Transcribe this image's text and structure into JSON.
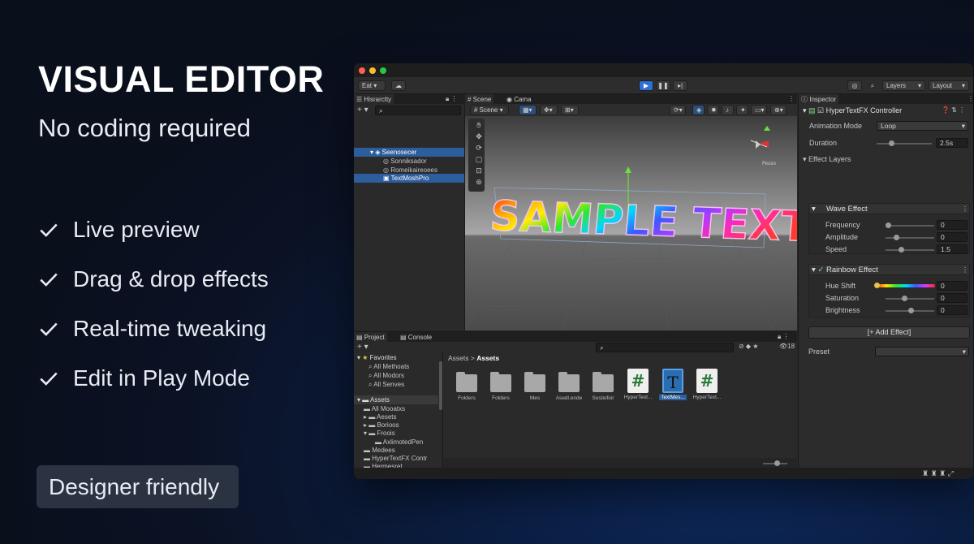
{
  "hero": {
    "title": "VISUAL EDITOR",
    "subtitle": "No coding required",
    "features": [
      "Live preview",
      "Drag & drop effects",
      "Real-time tweaking",
      "Edit in Play Mode"
    ],
    "badge": "Designer friendly"
  },
  "colors": {
    "accent": "#2c6fd6",
    "check": "#e8ebf2",
    "badge_bg": "#2b3343"
  },
  "editor": {
    "toolbar": {
      "left_btn": "Eat ▾",
      "layers": "Layers",
      "layout": "Layout"
    },
    "hierarchy": {
      "tab": "Hisrarctty",
      "items": [
        "Seenosecer",
        "Sonniksador",
        "Romeikaireoees",
        "TextMoshPro"
      ]
    },
    "scene": {
      "tabs": [
        "Scene",
        "Cama"
      ],
      "dropdown": "Scene",
      "gizmo_label": "Pesso",
      "sample_text": "SAMPLE TEXT"
    },
    "inspector": {
      "tab": "Inspector",
      "component": "HyperTextFX Controller",
      "animation_mode_label": "Animation Mode",
      "animation_mode_value": "Loop",
      "duration_label": "Duration",
      "duration_value": "2.5s",
      "effect_layers_label": "Effect Layers",
      "wave": {
        "title": "Wave Effect",
        "frequency_label": "Frequency",
        "frequency_value": "0",
        "amplitude_label": "Amplitude",
        "amplitude_value": "0",
        "speed_label": "Speed",
        "speed_value": "1.5"
      },
      "rainbow": {
        "title": "Rainbow Effect",
        "hue_label": "Hue Shift",
        "hue_value": "0",
        "saturation_label": "Saturation",
        "saturation_value": "0",
        "brightness_label": "Brightness",
        "brightness_value": "0"
      },
      "add_effect": "[+ Add Effect]",
      "preset_label": "Preset"
    },
    "project": {
      "tabs": [
        "Project",
        "Console"
      ],
      "favorites_label": "Favorites",
      "favorites": [
        "All Methoats",
        "All Modors",
        "All Senves"
      ],
      "assets_label": "Assets",
      "tree": [
        "All Mooatxs",
        "Aesets",
        "Borioos",
        "Froois",
        "AxlimotedPen",
        "Medees",
        "HyperTextFX Contr",
        "Hermesret"
      ],
      "breadcrumb_root": "Assets",
      "breadcrumb_current": "Assets",
      "count_label": "18",
      "assets": [
        {
          "icon": "folder-icon",
          "label": "Folders"
        },
        {
          "icon": "folder-icon",
          "label": "Folders"
        },
        {
          "icon": "folder-icon",
          "label": "Mes"
        },
        {
          "icon": "folder-icon",
          "label": "Asedl.ende"
        },
        {
          "icon": "folder-icon",
          "label": "Sostiofoir"
        },
        {
          "icon": "script-icon",
          "label": "HyperText..."
        },
        {
          "icon": "text-icon",
          "label": "TextMes..."
        },
        {
          "icon": "script-icon",
          "label": "HyperText..."
        }
      ]
    }
  }
}
